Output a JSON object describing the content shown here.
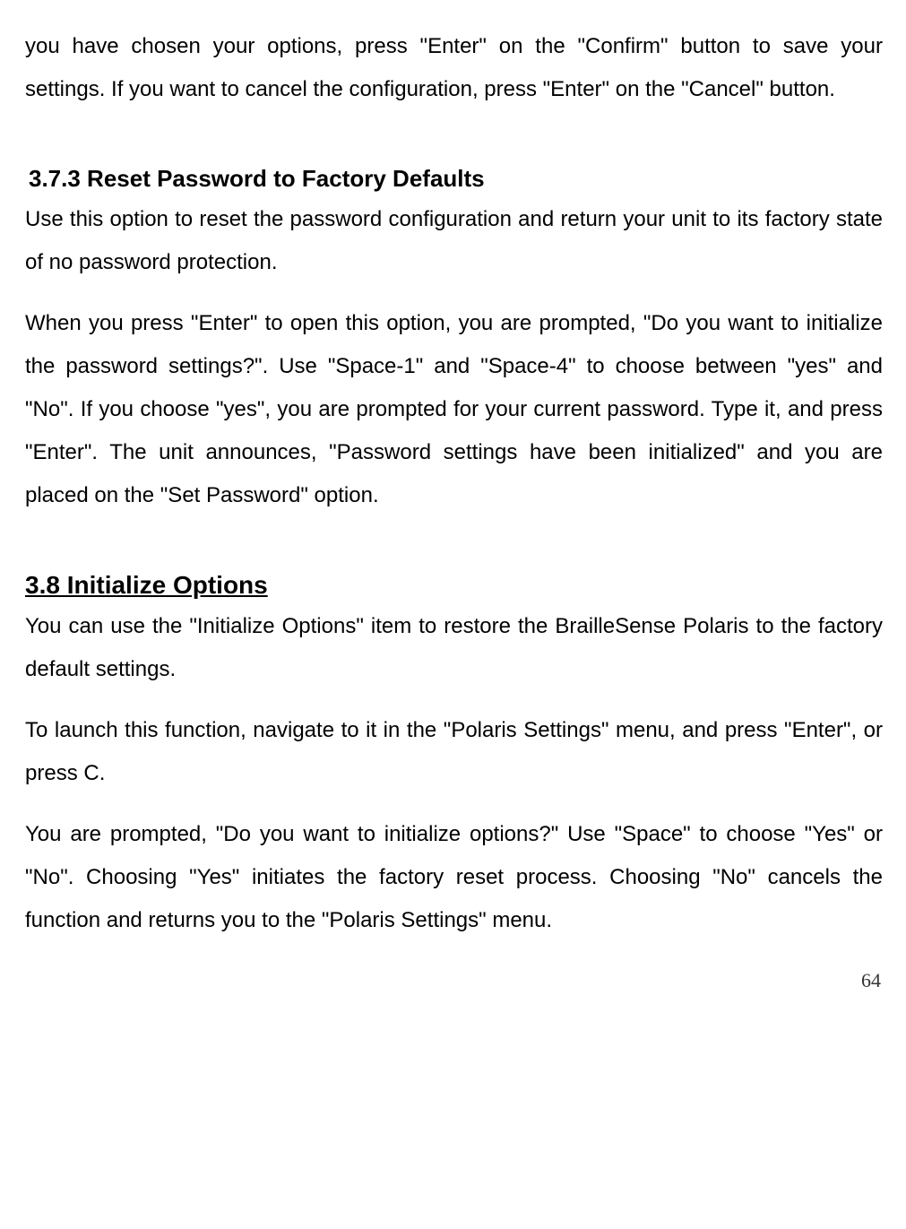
{
  "para_top": "you have chosen your options, press \"Enter\" on the \"Confirm\" button to save your settings. If you want to cancel the configuration, press \"Enter\" on the \"Cancel\" button.",
  "heading_373": "3.7.3 Reset Password to Factory Defaults",
  "para_373_1": "Use this option to reset the password configuration and return your unit to its factory state of no password protection.",
  "para_373_2": "When you press \"Enter\" to open this option, you are prompted, \"Do you want to initialize the password settings?\". Use \"Space-1\" and \"Space-4\" to choose between \"yes\" and \"No\". If you choose \"yes\", you are prompted for your current password. Type it, and press \"Enter\". The unit announces, \"Password settings have been initialized\" and you are placed on the \"Set Password\" option.",
  "heading_38": "3.8 Initialize Options",
  "para_38_1": "You can use the \"Initialize Options\" item to restore the BrailleSense Polaris to the factory default settings.",
  "para_38_2": "To launch this function, navigate to it in the \"Polaris Settings\" menu, and press \"Enter\", or press C.",
  "para_38_3": "You are prompted, \"Do you want to initialize options?\" Use \"Space\" to choose \"Yes\" or \"No\". Choosing \"Yes\" initiates the factory reset process. Choosing \"No\" cancels the function and returns you to the \"Polaris Settings\" menu.",
  "page_number": "64"
}
